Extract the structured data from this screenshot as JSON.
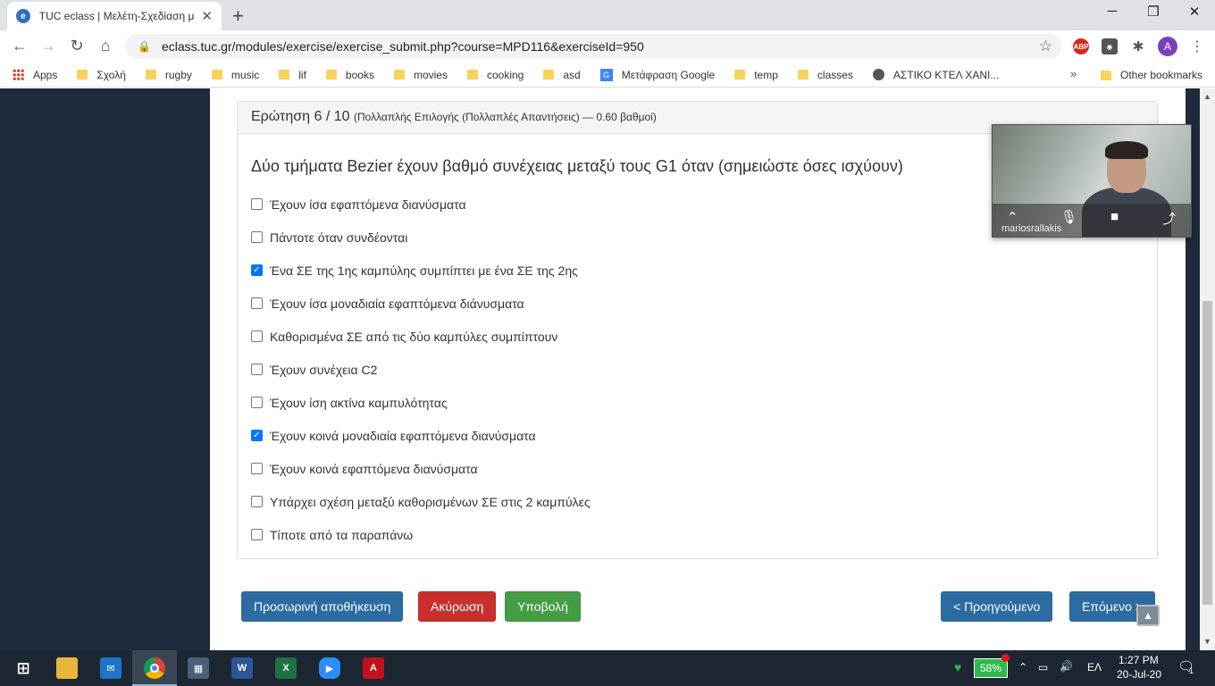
{
  "browser": {
    "tab_title": "TUC eclass | Μελέτη-Σχεδίαση μ",
    "url": "eclass.tuc.gr/modules/exercise/exercise_submit.php?course=MPD116&exerciseId=950",
    "avatar_letter": "A",
    "bookmarks": [
      "Apps",
      "Σχολή",
      "rugby",
      "music",
      "lif",
      "books",
      "movies",
      "cooking",
      "asd",
      "Μετάφραση Google",
      "temp",
      "classes",
      "ΑΣΤΙΚΟ ΚΤΕΛ ΧΑΝΙ..."
    ],
    "other_bookmarks": "Other bookmarks"
  },
  "question": {
    "heading": "Ερώτηση 6 / 10",
    "meta": "(Πολλαπλής Επιλογής (Πολλαπλές Απαντήσεις) — 0.60 βαθμοί)",
    "text": "Δύο τμήματα Bezier έχουν βαθμό συνέχειας μεταξύ τους G1 όταν (σημειώστε όσες ισχύουν)",
    "answers": [
      {
        "label": "Έχουν ίσα εφαπτόμενα διανύσματα",
        "checked": false
      },
      {
        "label": "Πάντοτε όταν συνδέονται",
        "checked": false
      },
      {
        "label": "Ένα ΣΕ της 1ης καμπύλης συμπίπτει με ένα ΣΕ της 2ης",
        "checked": true
      },
      {
        "label": "Έχουν ίσα μοναδιαία εφαπτόμενα διάνυσματα",
        "checked": false
      },
      {
        "label": "Καθορισμένα ΣΕ από τις δύο καμπύλες συμπίπτουν",
        "checked": false
      },
      {
        "label": "Έχουν συνέχεια C2",
        "checked": false
      },
      {
        "label": "Έχουν ίση ακτίνα καμπυλότητας",
        "checked": false
      },
      {
        "label": "Έχουν κοινά μοναδιαία εφαπτόμενα διανύσματα",
        "checked": true
      },
      {
        "label": "Έχουν κοινά εφαπτόμενα διανύσματα",
        "checked": false
      },
      {
        "label": "Υπάρχει σχέση μεταξύ καθορισμένων ΣΕ στις 2 καμπύλες",
        "checked": false
      },
      {
        "label": "Τίποτε από τα παραπάνω",
        "checked": false
      }
    ]
  },
  "actions": {
    "temp_save": "Προσωρινή αποθήκευση",
    "cancel": "Ακύρωση",
    "submit": "Υποβολή",
    "previous": "< Προηγούμενο",
    "next": "Επόμενο >"
  },
  "video_call": {
    "participant": "mariosrallakis"
  },
  "taskbar": {
    "battery": "58%",
    "language": "ΕΛ",
    "time": "1:27 PM",
    "date": "20-Jul-20",
    "notifications": "1"
  },
  "colors": {
    "primary": "#2d6ca2",
    "danger": "#c9302c",
    "success": "#449d44",
    "sidebar": "#1f2a3c"
  }
}
